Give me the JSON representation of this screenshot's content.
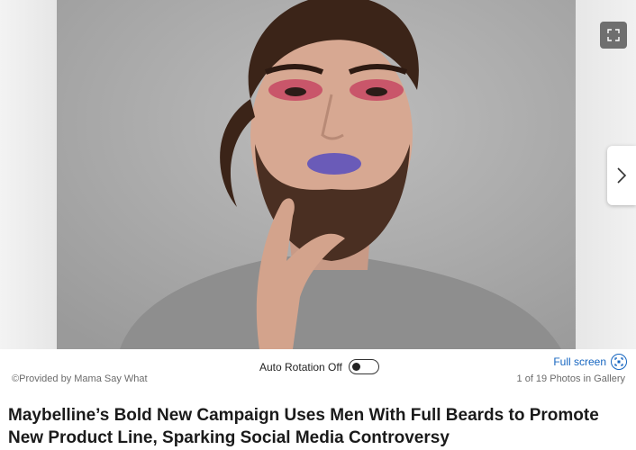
{
  "gallery": {
    "photo_alt": "Bearded man wearing pink eyeshadow and purple lipstick",
    "credit": "©Provided by Mama Say What",
    "counter": "1 of 19 Photos in Gallery",
    "auto_rotation_label": "Auto Rotation Off",
    "auto_rotation_on": false,
    "fullscreen_label": "Full screen",
    "expand_icon": "expand-icon",
    "next_icon": "chevron-right-icon"
  },
  "article": {
    "headline": "Maybelline’s Bold New Campaign Uses Men With Full Beards to Promote New Product Line, Sparking Social Media Controversy"
  },
  "colors": {
    "link": "#1565c0",
    "text": "#1a1a1a",
    "muted": "#6b6b6b"
  }
}
